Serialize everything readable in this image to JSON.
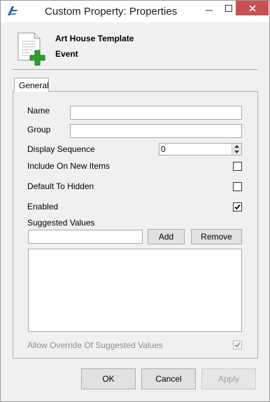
{
  "window": {
    "title": "Custom Property: Properties",
    "app_icon": "app-logo-icon",
    "controls": [
      "minimize-icon",
      "maximize-icon",
      "close-icon"
    ]
  },
  "header": {
    "icon": "document-add-icon",
    "title": "Art House Template",
    "subtitle": "Event"
  },
  "tabs": [
    {
      "label": "General",
      "selected": true
    }
  ],
  "form": {
    "name_label": "Name",
    "name_value": "",
    "group_label": "Group",
    "group_value": "",
    "display_sequence_label": "Display Sequence",
    "display_sequence_value": "0",
    "include_new_items_label": "Include On New Items",
    "include_new_items_checked": false,
    "default_hidden_label": "Default To Hidden",
    "default_hidden_checked": false,
    "enabled_label": "Enabled",
    "enabled_checked": true,
    "suggested_values_label": "Suggested Values",
    "suggested_value_input": "",
    "add_label": "Add",
    "remove_label": "Remove",
    "suggested_values_list": [],
    "allow_override_label": "Allow Override Of Suggested Values",
    "allow_override_checked": true
  },
  "footer": {
    "ok_label": "OK",
    "cancel_label": "Cancel",
    "apply_label": "Apply"
  },
  "colors": {
    "close_button": "#c75050",
    "titlebar": "#ffffff",
    "dialog": "#f0f0f0",
    "plus_green": "#2e9e2e"
  }
}
